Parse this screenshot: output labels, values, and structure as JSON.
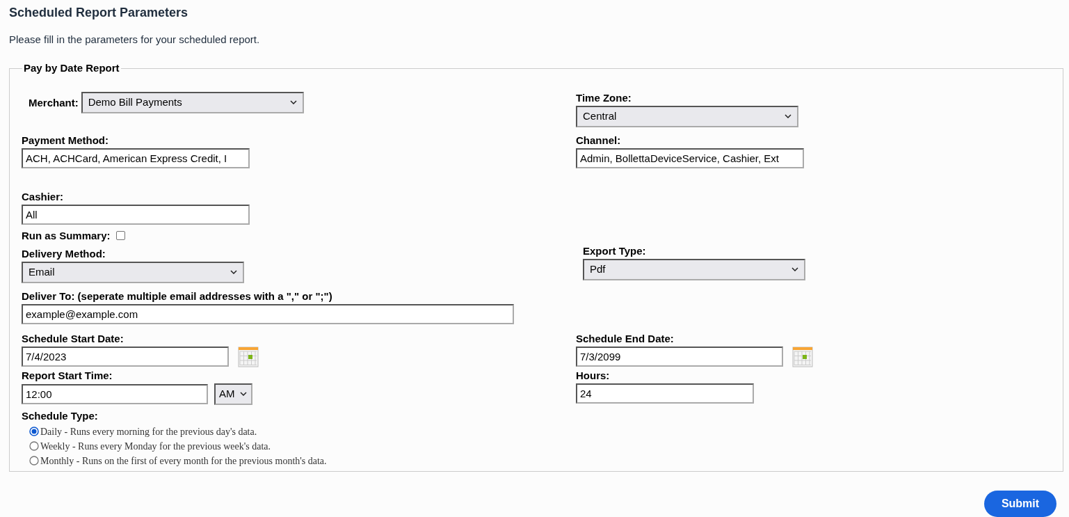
{
  "page": {
    "title": "Scheduled Report Parameters",
    "intro": "Please fill in the parameters for your scheduled report."
  },
  "report": {
    "legend": "Pay by Date Report",
    "merchant": {
      "label": "Merchant:",
      "value": "Demo Bill Payments"
    },
    "time_zone": {
      "label": "Time Zone:",
      "value": "Central"
    },
    "payment_method": {
      "label": "Payment Method:",
      "value": "ACH, ACHCard, American Express Credit, I"
    },
    "channel": {
      "label": "Channel:",
      "value": "Admin, BollettaDeviceService, Cashier, Ext"
    },
    "cashier": {
      "label": "Cashier:",
      "value": "All"
    },
    "run_as_summary": {
      "label": "Run as Summary:",
      "checked": false
    },
    "delivery_method": {
      "label": "Delivery Method:",
      "value": "Email"
    },
    "export_type": {
      "label": "Export Type:",
      "value": "Pdf"
    },
    "deliver_to": {
      "label": "Deliver To: (seperate multiple email addresses with a \",\" or \";\")",
      "value": "example@example.com"
    },
    "schedule_start_date": {
      "label": "Schedule Start Date:",
      "value": "7/4/2023"
    },
    "schedule_end_date": {
      "label": "Schedule End Date:",
      "value": "7/3/2099"
    },
    "report_start_time": {
      "label": "Report Start Time:",
      "value": "12:00",
      "meridiem": "AM"
    },
    "hours": {
      "label": "Hours:",
      "value": "24"
    },
    "schedule_type": {
      "label": "Schedule Type:",
      "options": [
        {
          "label": "Daily - Runs every morning for the previous day's data.",
          "selected": true
        },
        {
          "label": "Weekly - Runs every Monday for the previous week's data.",
          "selected": false
        },
        {
          "label": "Monthly - Runs on the first of every month for the previous month's data.",
          "selected": false
        }
      ]
    }
  },
  "submit": "Submit"
}
